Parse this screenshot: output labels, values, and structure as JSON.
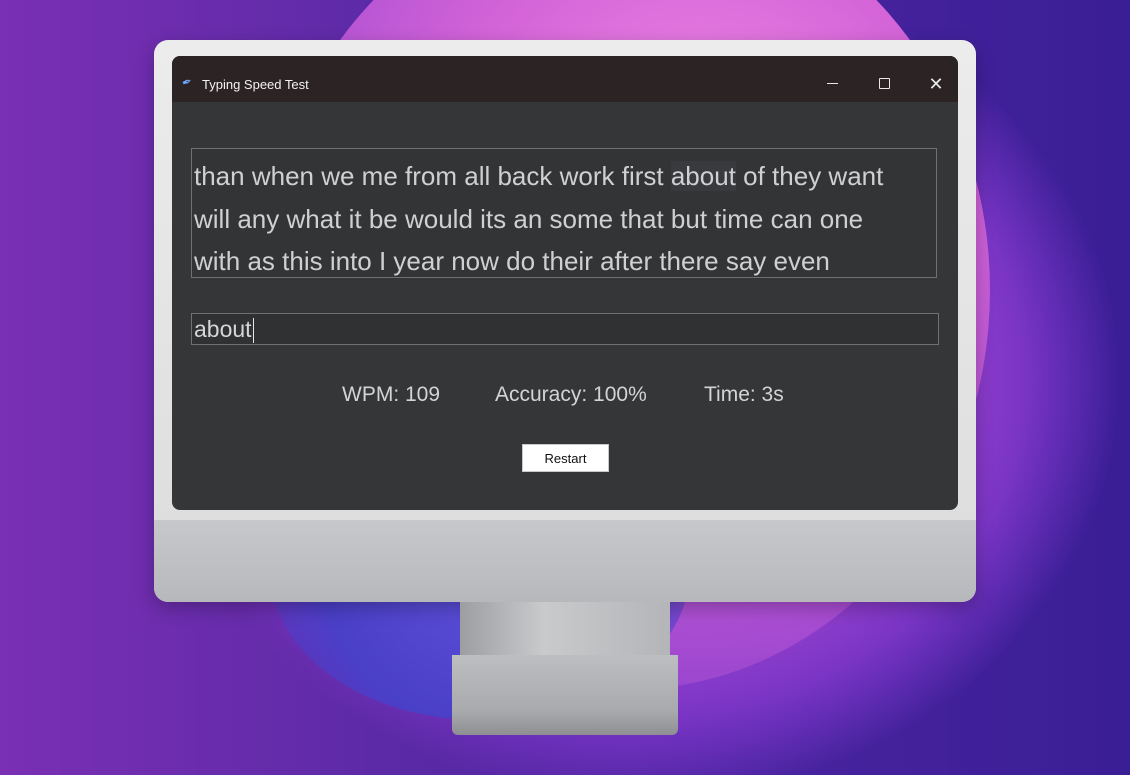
{
  "window": {
    "title": "Typing Speed Test",
    "icon": "feather-icon",
    "controls": {
      "minimize": "minimize-icon",
      "maximize": "maximize-icon",
      "close": "close-icon"
    }
  },
  "passage": {
    "lines": [
      {
        "before": "than when we me from all back work first ",
        "current": "about",
        "after": " of they want"
      },
      {
        "text": "will any what it be would its an some that but time can one"
      },
      {
        "text": "with as this into I year now do their after there say even"
      }
    ]
  },
  "input": {
    "value": "about"
  },
  "stats": {
    "wpm": "WPM: 109",
    "accuracy": "Accuracy: 100%",
    "time": "Time: 3s"
  },
  "restart_label": "Restart",
  "colors": {
    "window_bg": "#343638",
    "titlebar_bg": "#2c2424",
    "text": "#cfd0d2",
    "button_bg": "#ffffff"
  }
}
